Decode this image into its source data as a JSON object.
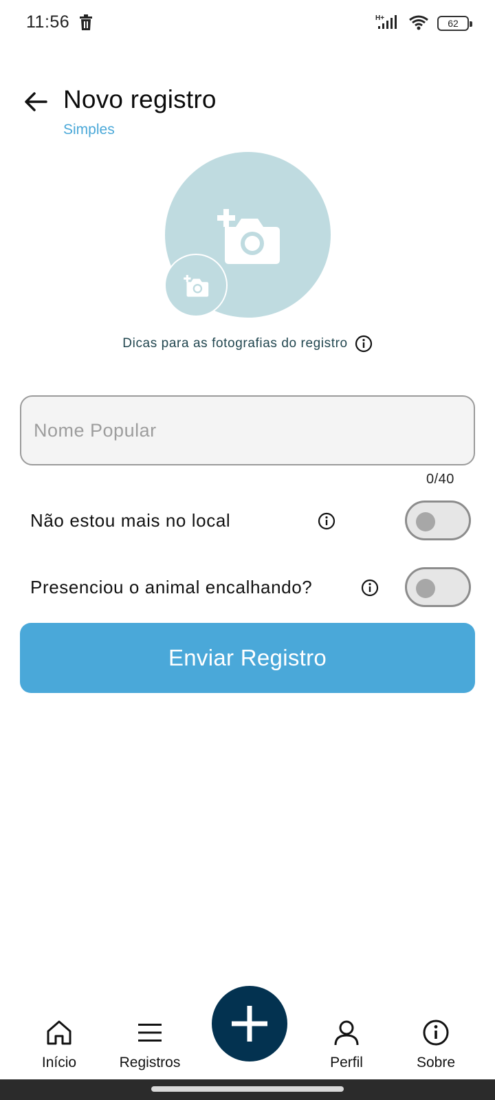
{
  "status_bar": {
    "time": "11:56",
    "network": "H+",
    "battery": "62"
  },
  "header": {
    "title": "Novo registro",
    "subtitle": "Simples"
  },
  "photo": {
    "tips_label": "Dicas para as fotografias do registro"
  },
  "form": {
    "name_placeholder": "Nome Popular",
    "name_value": "",
    "counter": "0/40",
    "toggles": [
      {
        "label": "Não estou mais no local",
        "on": false
      },
      {
        "label": "Presenciou o animal encalhando?",
        "on": false
      }
    ],
    "submit_label": "Enviar Registro"
  },
  "bottom_nav": {
    "items": [
      {
        "label": "Início",
        "icon": "home-icon"
      },
      {
        "label": "Registros",
        "icon": "menu-icon"
      },
      {
        "label": "Perfil",
        "icon": "person-icon"
      },
      {
        "label": "Sobre",
        "icon": "info-icon"
      }
    ],
    "fab_icon": "plus-icon"
  },
  "colors": {
    "accent": "#4aa8d9",
    "photo_bg": "#bfdbe0",
    "fab": "#033250",
    "tips_text": "#21464f"
  }
}
